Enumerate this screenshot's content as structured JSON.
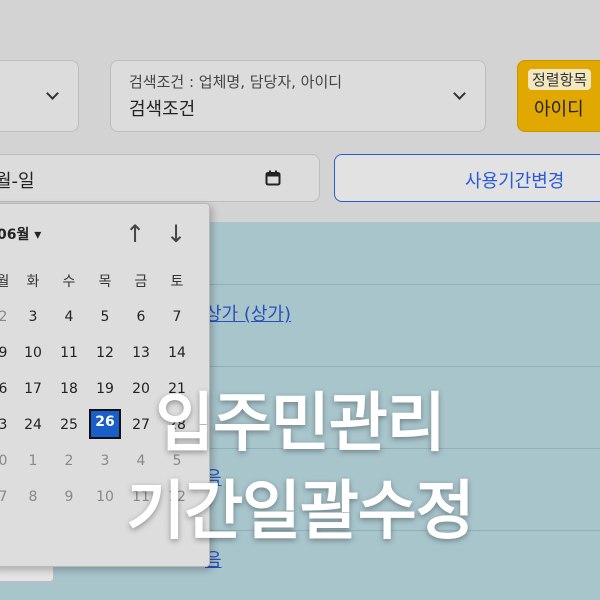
{
  "search_condition": {
    "hint": "검색조건 : 업체명, 담당자, 아이디",
    "value": "검색조건"
  },
  "sort_field": {
    "hint": "정렬항목",
    "value": "아이디",
    "color": "#e0a800"
  },
  "date_input": {
    "value": "월-일"
  },
  "change_period_button": {
    "label": "사용기간변경"
  },
  "table": {
    "link1": "상가 (상가)",
    "link2": "음",
    "link3": "음"
  },
  "calendar": {
    "month_label": "06월 ▾",
    "up_arrow": "↑",
    "down_arrow": "↓",
    "weekdays": [
      "월",
      "화",
      "수",
      "목",
      "금",
      "토"
    ],
    "rows": [
      [
        "2",
        "3",
        "4",
        "5",
        "6",
        "7"
      ],
      [
        "9",
        "10",
        "11",
        "12",
        "13",
        "14"
      ],
      [
        "6",
        "17",
        "18",
        "19",
        "20",
        "21"
      ],
      [
        "3",
        "24",
        "25",
        "26",
        "27",
        "28"
      ],
      [
        "0",
        "1",
        "2",
        "3",
        "4",
        "5"
      ],
      [
        "7",
        "8",
        "9",
        "10",
        "11",
        "12"
      ]
    ],
    "selected_day": "26",
    "accent": "#1a5fc9"
  },
  "overlay": {
    "line1": "입주민관리",
    "line2": "기간일괄수정"
  }
}
